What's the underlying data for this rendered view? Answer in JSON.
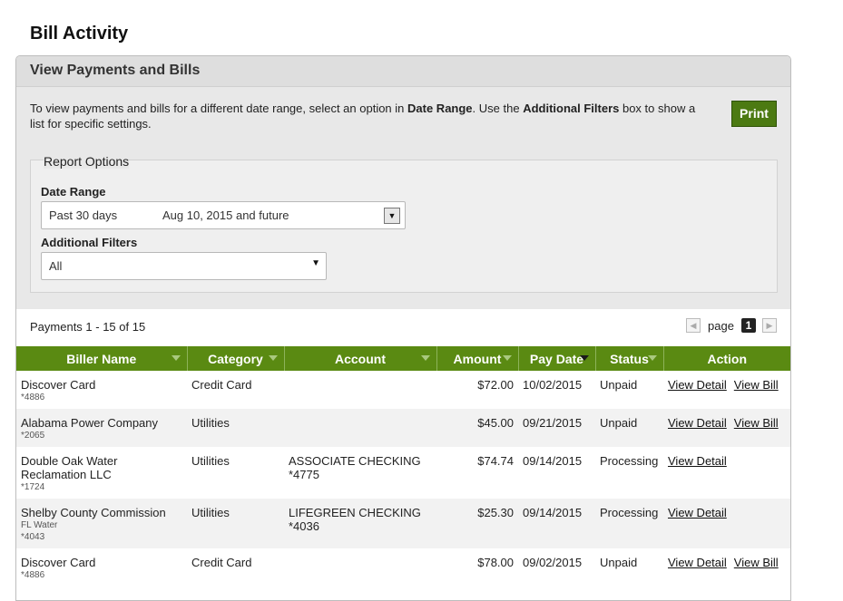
{
  "page": {
    "title": "Bill Activity"
  },
  "panel": {
    "header": "View Payments and Bills",
    "intro": {
      "part1": "To view payments and bills for a different date range, select an option in ",
      "bold1": "Date Range",
      "part2": ". Use the ",
      "bold2": "Additional Filters",
      "part3": " box to show a list for specific settings."
    },
    "print_label": "Print"
  },
  "report_options": {
    "legend": "Report Options",
    "date_range_label": "Date Range",
    "date_range_value": "Past 30 days",
    "date_range_detail": "Aug 10, 2015 and future",
    "filters_label": "Additional Filters",
    "filters_value": "All"
  },
  "summary": {
    "text": "Payments 1 - 15 of 15",
    "page_label": "page",
    "page_number": "1"
  },
  "table": {
    "headers": [
      "Biller Name",
      "Category",
      "Account",
      "Amount",
      "Pay Date",
      "Status",
      "Action"
    ],
    "rows": [
      {
        "biller": "Discover Card",
        "biller_sub1": "*4886",
        "biller_sub2": "",
        "category": "Credit Card",
        "account": "",
        "account2": "",
        "amount": "$72.00",
        "pay_date": "10/02/2015",
        "status": "Unpaid",
        "action1": "View Detail",
        "action2": "View Bill"
      },
      {
        "biller": "Alabama Power Company",
        "biller_sub1": "*2065",
        "biller_sub2": "",
        "category": "Utilities",
        "account": "",
        "account2": "",
        "amount": "$45.00",
        "pay_date": "09/21/2015",
        "status": "Unpaid",
        "action1": "View Detail",
        "action2": "View Bill"
      },
      {
        "biller": "Double Oak Water Reclamation LLC",
        "biller_sub1": "*1724",
        "biller_sub2": "",
        "category": "Utilities",
        "account": "ASSOCIATE CHECKING",
        "account2": "*4775",
        "amount": "$74.74",
        "pay_date": "09/14/2015",
        "status": "Processing",
        "action1": "View Detail",
        "action2": ""
      },
      {
        "biller": "Shelby County Commission",
        "biller_sub1": "FL Water",
        "biller_sub2": "*4043",
        "category": "Utilities",
        "account": "LIFEGREEN CHECKING",
        "account2": "*4036",
        "amount": "$25.30",
        "pay_date": "09/14/2015",
        "status": "Processing",
        "action1": "View Detail",
        "action2": ""
      },
      {
        "biller": "Discover Card",
        "biller_sub1": "*4886",
        "biller_sub2": "",
        "category": "Credit Card",
        "account": "",
        "account2": "",
        "amount": "$78.00",
        "pay_date": "09/02/2015",
        "status": "Unpaid",
        "action1": "View Detail",
        "action2": "View Bill"
      }
    ]
  },
  "colors": {
    "header_green": "#5a8a12",
    "button_green": "#4c7a12"
  }
}
